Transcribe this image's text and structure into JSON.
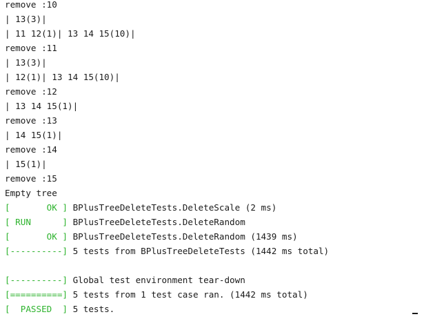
{
  "terminal": {
    "lines": [
      {
        "text": "remove :10"
      },
      {
        "text": "| 13(3)|"
      },
      {
        "text": "| 11 12(1)| 13 14 15(10)|"
      },
      {
        "text": "remove :11"
      },
      {
        "text": "| 13(3)|"
      },
      {
        "text": "| 12(1)| 13 14 15(10)|"
      },
      {
        "text": "remove :12"
      },
      {
        "text": "| 13 14 15(1)|"
      },
      {
        "text": "remove :13"
      },
      {
        "text": "| 14 15(1)|"
      },
      {
        "text": "remove :14"
      },
      {
        "text": "| 15(1)|"
      },
      {
        "text": "remove :15"
      },
      {
        "text": "Empty tree"
      },
      {
        "tag": "[       OK ]",
        "text": " BPlusTreeDeleteTests.DeleteScale (2 ms)"
      },
      {
        "tag": "[ RUN      ]",
        "text": " BPlusTreeDeleteTests.DeleteRandom"
      },
      {
        "tag": "[       OK ]",
        "text": " BPlusTreeDeleteTests.DeleteRandom (1439 ms)"
      },
      {
        "tag": "[----------]",
        "text": " 5 tests from BPlusTreeDeleteTests (1442 ms total)"
      },
      {
        "text": ""
      },
      {
        "tag": "[----------]",
        "text": " Global test environment tear-down"
      },
      {
        "tag": "[==========]",
        "text": " 5 tests from 1 test case ran. (1442 ms total)"
      },
      {
        "tag": "[  PASSED  ]",
        "text": " 5 tests."
      }
    ]
  },
  "colors": {
    "gtest_tag": "#2db32d",
    "text": "#1a1a1a",
    "background": "#ffffff"
  }
}
